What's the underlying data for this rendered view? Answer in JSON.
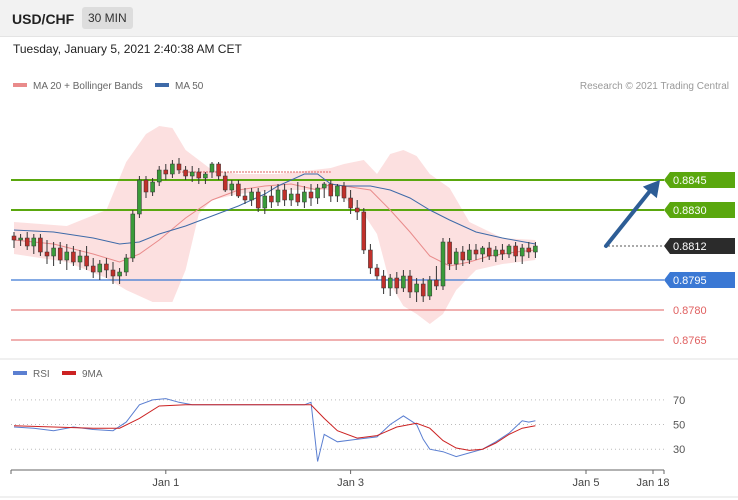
{
  "header": {
    "symbol": "USD/CHF",
    "timeframe": "30 MIN",
    "datetime": "Tuesday, January 5, 2021 2:40:38 AM CET",
    "legend_ma20": "MA 20 + Bollinger Bands",
    "legend_ma50": "MA 50",
    "credit": "Research © 2021 Trading Central"
  },
  "colors": {
    "ma20": "#e98b8b",
    "ma50": "#3e6aa8",
    "bollinger": "#fbdada",
    "candle_up": "#3a9b3a",
    "candle_down": "#c0302b",
    "resistance": "#5aa70e",
    "support": "#3a78d4",
    "lower_level": "#e06060",
    "current": "#2b2b2b",
    "arrow": "#2d5d96",
    "rsi": "#5b7fd1",
    "rsi_ma": "#cc2222"
  },
  "chart_data": [
    {
      "type": "candlestick",
      "title": "USD/CHF 30 MIN",
      "x_ticks": [
        "Jan 1",
        "Jan 3",
        "Jan 5",
        "Jan 18"
      ],
      "ylim": [
        0.8757,
        0.8885
      ],
      "price_levels": [
        {
          "name": "resistance-2",
          "value": 0.8845,
          "label": "0.8845",
          "kind": "resistance"
        },
        {
          "name": "resistance-1",
          "value": 0.883,
          "label": "0.8830",
          "kind": "resistance"
        },
        {
          "name": "current",
          "value": 0.8812,
          "label": "0.8812",
          "kind": "current"
        },
        {
          "name": "support-1",
          "value": 0.8795,
          "label": "0.8795",
          "kind": "support"
        },
        {
          "name": "support-2",
          "value": 0.878,
          "label": "0.8780",
          "kind": "lower"
        },
        {
          "name": "support-3",
          "value": 0.8765,
          "label": "0.8765",
          "kind": "lower"
        }
      ],
      "forecast_arrow": {
        "from": 0.8812,
        "to": 0.8845
      },
      "candles": [
        [
          0.8817,
          0.8819,
          0.8811,
          0.8815
        ],
        [
          0.8815,
          0.8818,
          0.8812,
          0.8816
        ],
        [
          0.8816,
          0.8819,
          0.881,
          0.8812
        ],
        [
          0.8812,
          0.8818,
          0.8808,
          0.8816
        ],
        [
          0.8816,
          0.8818,
          0.8807,
          0.8809
        ],
        [
          0.8809,
          0.8815,
          0.8803,
          0.8807
        ],
        [
          0.8807,
          0.8814,
          0.8802,
          0.8811
        ],
        [
          0.8811,
          0.8814,
          0.8803,
          0.8805
        ],
        [
          0.8805,
          0.8813,
          0.88,
          0.8809
        ],
        [
          0.8809,
          0.8812,
          0.8802,
          0.8804
        ],
        [
          0.8804,
          0.881,
          0.88,
          0.8807
        ],
        [
          0.8807,
          0.8812,
          0.88,
          0.8802
        ],
        [
          0.8802,
          0.8806,
          0.8796,
          0.8799
        ],
        [
          0.8799,
          0.8805,
          0.8795,
          0.8803
        ],
        [
          0.8803,
          0.8806,
          0.8796,
          0.88
        ],
        [
          0.88,
          0.8804,
          0.8793,
          0.8797
        ],
        [
          0.8797,
          0.8801,
          0.8793,
          0.8799
        ],
        [
          0.8799,
          0.8808,
          0.8797,
          0.8806
        ],
        [
          0.8806,
          0.883,
          0.8804,
          0.8828
        ],
        [
          0.8828,
          0.8847,
          0.8826,
          0.8845
        ],
        [
          0.8845,
          0.8847,
          0.8836,
          0.8839
        ],
        [
          0.8839,
          0.8846,
          0.8837,
          0.8844
        ],
        [
          0.8844,
          0.8852,
          0.8842,
          0.885
        ],
        [
          0.885,
          0.8853,
          0.8845,
          0.8848
        ],
        [
          0.8848,
          0.8855,
          0.8846,
          0.8853
        ],
        [
          0.8853,
          0.8856,
          0.8848,
          0.885
        ],
        [
          0.885,
          0.8852,
          0.8845,
          0.8847
        ],
        [
          0.8847,
          0.8852,
          0.8844,
          0.8849
        ],
        [
          0.8849,
          0.8851,
          0.8843,
          0.8846
        ],
        [
          0.8846,
          0.8849,
          0.8843,
          0.8848
        ],
        [
          0.8849,
          0.8854,
          0.8846,
          0.8853
        ],
        [
          0.8853,
          0.8854,
          0.8845,
          0.8847
        ],
        [
          0.8847,
          0.8849,
          0.8839,
          0.884
        ],
        [
          0.884,
          0.8845,
          0.8837,
          0.8843
        ],
        [
          0.8843,
          0.8845,
          0.8836,
          0.8837
        ],
        [
          0.8837,
          0.8841,
          0.8833,
          0.8835
        ],
        [
          0.8835,
          0.8841,
          0.8832,
          0.8839
        ],
        [
          0.8839,
          0.8841,
          0.8829,
          0.8831
        ],
        [
          0.8831,
          0.884,
          0.8828,
          0.8837
        ],
        [
          0.8837,
          0.8842,
          0.8831,
          0.8834
        ],
        [
          0.8834,
          0.8843,
          0.8832,
          0.884
        ],
        [
          0.884,
          0.8843,
          0.8832,
          0.8835
        ],
        [
          0.8835,
          0.8841,
          0.8832,
          0.8838
        ],
        [
          0.8838,
          0.8844,
          0.8832,
          0.8834
        ],
        [
          0.8834,
          0.8842,
          0.8831,
          0.8839
        ],
        [
          0.8839,
          0.8843,
          0.8832,
          0.8836
        ],
        [
          0.8836,
          0.8843,
          0.8833,
          0.8841
        ],
        [
          0.8841,
          0.8844,
          0.8836,
          0.8843
        ],
        [
          0.8843,
          0.8845,
          0.8834,
          0.8837
        ],
        [
          0.8837,
          0.8843,
          0.8834,
          0.8842
        ],
        [
          0.8842,
          0.8844,
          0.8834,
          0.8836
        ],
        [
          0.8836,
          0.884,
          0.8828,
          0.8831
        ],
        [
          0.8831,
          0.8835,
          0.8825,
          0.8829
        ],
        [
          0.8829,
          0.8831,
          0.8808,
          0.881
        ],
        [
          0.881,
          0.8813,
          0.8798,
          0.8801
        ],
        [
          0.8801,
          0.8803,
          0.8795,
          0.8797
        ],
        [
          0.8797,
          0.88,
          0.8788,
          0.8791
        ],
        [
          0.8791,
          0.8798,
          0.8787,
          0.8796
        ],
        [
          0.8796,
          0.8799,
          0.8788,
          0.8791
        ],
        [
          0.8791,
          0.88,
          0.8789,
          0.8797
        ],
        [
          0.8797,
          0.88,
          0.8786,
          0.8789
        ],
        [
          0.8789,
          0.8796,
          0.8784,
          0.8793
        ],
        [
          0.8793,
          0.8796,
          0.8784,
          0.8787
        ],
        [
          0.8787,
          0.8797,
          0.8785,
          0.8795
        ],
        [
          0.8795,
          0.8802,
          0.879,
          0.8792
        ],
        [
          0.8792,
          0.8816,
          0.879,
          0.8814
        ],
        [
          0.8814,
          0.8816,
          0.88,
          0.8803
        ],
        [
          0.8803,
          0.8811,
          0.88,
          0.8809
        ],
        [
          0.8809,
          0.8812,
          0.8802,
          0.8805
        ],
        [
          0.8805,
          0.8813,
          0.8803,
          0.881
        ],
        [
          0.881,
          0.8813,
          0.8805,
          0.8808
        ],
        [
          0.8808,
          0.8812,
          0.8804,
          0.8811
        ],
        [
          0.8811,
          0.8814,
          0.8805,
          0.8807
        ],
        [
          0.8807,
          0.8812,
          0.8804,
          0.881
        ],
        [
          0.881,
          0.8813,
          0.8805,
          0.8808
        ],
        [
          0.8808,
          0.8813,
          0.8806,
          0.8812
        ],
        [
          0.8812,
          0.8814,
          0.8804,
          0.8807
        ],
        [
          0.8807,
          0.8813,
          0.8803,
          0.8811
        ],
        [
          0.8811,
          0.8814,
          0.8806,
          0.8809
        ],
        [
          0.8809,
          0.8814,
          0.8806,
          0.8812
        ]
      ],
      "ma20": [
        [
          0,
          0.8815
        ],
        [
          6,
          0.8813
        ],
        [
          12,
          0.8808
        ],
        [
          16,
          0.8804
        ],
        [
          19,
          0.8808
        ],
        [
          22,
          0.8815
        ],
        [
          26,
          0.8826
        ],
        [
          30,
          0.8835
        ],
        [
          34,
          0.884
        ],
        [
          38,
          0.8842
        ],
        [
          42,
          0.8843
        ],
        [
          46,
          0.884
        ],
        [
          48,
          0.8843
        ],
        [
          50,
          0.8842
        ],
        [
          54,
          0.884
        ],
        [
          57,
          0.883
        ],
        [
          60,
          0.8819
        ],
        [
          63,
          0.8807
        ],
        [
          66,
          0.8802
        ],
        [
          69,
          0.8804
        ],
        [
          72,
          0.8807
        ],
        [
          76,
          0.8809
        ],
        [
          79,
          0.881
        ]
      ],
      "ma50": [
        [
          0,
          0.882
        ],
        [
          6,
          0.8819
        ],
        [
          12,
          0.8816
        ],
        [
          16,
          0.8813
        ],
        [
          19,
          0.8814
        ],
        [
          22,
          0.8818
        ],
        [
          26,
          0.8822
        ],
        [
          30,
          0.8827
        ],
        [
          34,
          0.8832
        ],
        [
          38,
          0.8838
        ],
        [
          40,
          0.8842
        ],
        [
          44,
          0.8848
        ],
        [
          46,
          0.8848
        ],
        [
          48,
          0.8843
        ],
        [
          50,
          0.8842
        ],
        [
          54,
          0.8842
        ],
        [
          57,
          0.884
        ],
        [
          60,
          0.8836
        ],
        [
          63,
          0.883
        ],
        [
          66,
          0.8825
        ],
        [
          70,
          0.8819
        ],
        [
          74,
          0.8816
        ],
        [
          79,
          0.8813
        ]
      ],
      "bollinger_upper": [
        [
          0,
          0.8824
        ],
        [
          8,
          0.8822
        ],
        [
          14,
          0.883
        ],
        [
          17,
          0.8854
        ],
        [
          20,
          0.8868
        ],
        [
          22,
          0.8872
        ],
        [
          24,
          0.8871
        ],
        [
          26,
          0.886
        ],
        [
          28,
          0.8855
        ],
        [
          30,
          0.885
        ],
        [
          34,
          0.8848
        ],
        [
          40,
          0.8848
        ],
        [
          48,
          0.8851
        ],
        [
          50,
          0.8853
        ],
        [
          53,
          0.8855
        ],
        [
          55,
          0.8848
        ],
        [
          57,
          0.8858
        ],
        [
          59,
          0.886
        ],
        [
          61,
          0.8857
        ],
        [
          63,
          0.8848
        ],
        [
          66,
          0.8841
        ],
        [
          69,
          0.8824
        ],
        [
          74,
          0.8816
        ],
        [
          79,
          0.8815
        ]
      ],
      "bollinger_lower": [
        [
          0,
          0.8808
        ],
        [
          8,
          0.8804
        ],
        [
          14,
          0.8796
        ],
        [
          17,
          0.879
        ],
        [
          19,
          0.8787
        ],
        [
          21,
          0.8784
        ],
        [
          24,
          0.8784
        ],
        [
          26,
          0.88
        ],
        [
          28,
          0.8828
        ],
        [
          30,
          0.8835
        ],
        [
          34,
          0.8838
        ],
        [
          40,
          0.884
        ],
        [
          48,
          0.884
        ],
        [
          50,
          0.8836
        ],
        [
          53,
          0.8828
        ],
        [
          55,
          0.8818
        ],
        [
          57,
          0.8793
        ],
        [
          59,
          0.8782
        ],
        [
          61,
          0.8778
        ],
        [
          63,
          0.8773
        ],
        [
          65,
          0.8778
        ],
        [
          67,
          0.879
        ],
        [
          70,
          0.88
        ],
        [
          74,
          0.8803
        ],
        [
          79,
          0.8805
        ]
      ]
    },
    {
      "type": "line",
      "title": "RSI",
      "series": [
        {
          "name": "RSI",
          "values": [
            [
              0,
              48
            ],
            [
              3,
              47
            ],
            [
              6,
              45
            ],
            [
              9,
              48
            ],
            [
              12,
              46
            ],
            [
              15,
              45
            ],
            [
              17,
              52
            ],
            [
              19,
              66
            ],
            [
              21,
              70
            ],
            [
              23,
              71
            ],
            [
              25,
              68
            ],
            [
              27,
              66
            ],
            [
              29,
              66
            ],
            [
              31,
              66
            ],
            [
              34,
              66
            ],
            [
              40,
              66
            ],
            [
              44,
              66
            ],
            [
              45,
              68
            ],
            [
              46,
              20
            ],
            [
              47,
              42
            ],
            [
              49,
              36
            ],
            [
              52,
              38
            ],
            [
              55,
              40
            ],
            [
              57,
              50
            ],
            [
              59,
              57
            ],
            [
              61,
              50
            ],
            [
              62,
              38
            ],
            [
              63,
              30
            ],
            [
              65,
              28
            ],
            [
              67,
              24
            ],
            [
              69,
              27
            ],
            [
              71,
              30
            ],
            [
              73,
              36
            ],
            [
              75,
              43
            ],
            [
              77,
              53
            ],
            [
              78,
              52
            ],
            [
              79,
              53
            ]
          ]
        },
        {
          "name": "9MA",
          "values": [
            [
              0,
              49
            ],
            [
              6,
              48
            ],
            [
              12,
              47
            ],
            [
              16,
              47
            ],
            [
              19,
              55
            ],
            [
              22,
              65
            ],
            [
              26,
              66
            ],
            [
              30,
              66
            ],
            [
              34,
              66
            ],
            [
              40,
              66
            ],
            [
              45,
              66
            ],
            [
              47,
              55
            ],
            [
              49,
              45
            ],
            [
              52,
              39
            ],
            [
              55,
              41
            ],
            [
              58,
              48
            ],
            [
              61,
              51
            ],
            [
              63,
              47
            ],
            [
              65,
              37
            ],
            [
              67,
              31
            ],
            [
              69,
              29
            ],
            [
              71,
              30
            ],
            [
              73,
              35
            ],
            [
              75,
              42
            ],
            [
              77,
              47
            ],
            [
              79,
              49
            ]
          ]
        }
      ],
      "ylim": [
        18,
        78
      ],
      "y_ticks": [
        70,
        50,
        30
      ],
      "reference_line": 50
    }
  ]
}
